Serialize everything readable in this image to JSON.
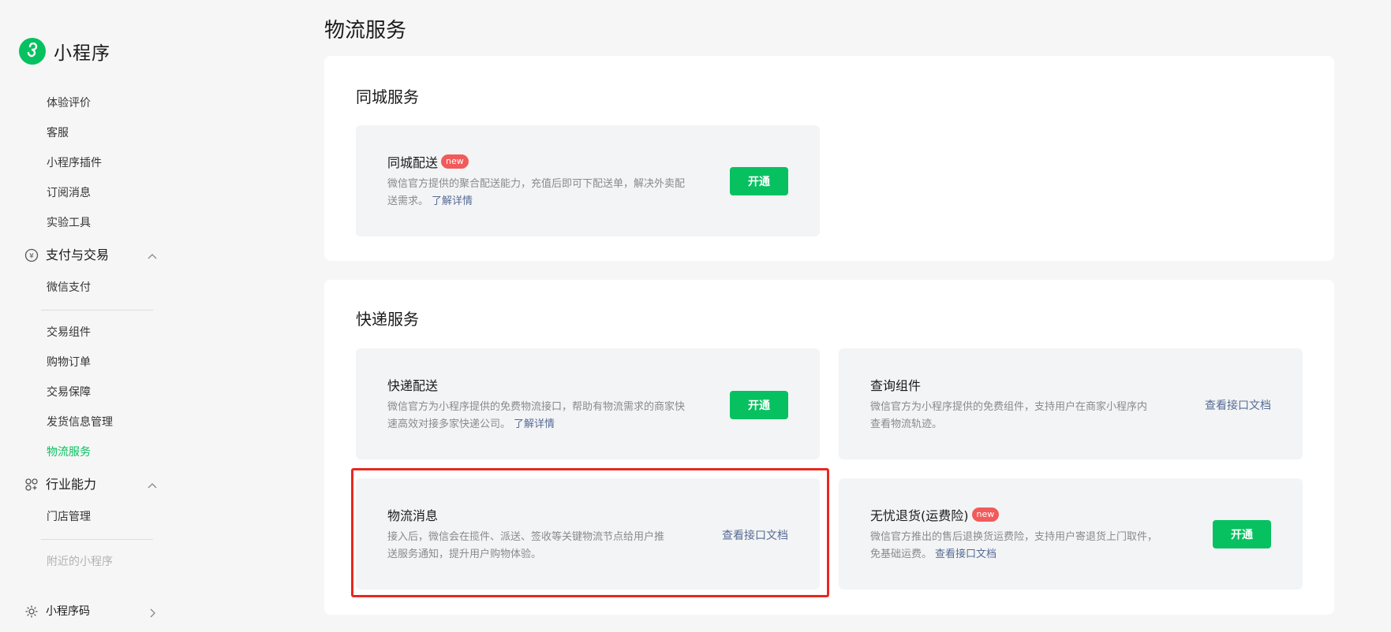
{
  "brand": {
    "name": "小程序"
  },
  "sidebar": {
    "items_top": [
      {
        "label": "体验评价"
      },
      {
        "label": "客服"
      },
      {
        "label": "小程序插件"
      },
      {
        "label": "订阅消息"
      },
      {
        "label": "实验工具"
      }
    ],
    "group_payment": {
      "label": "支付与交易",
      "items": [
        {
          "label": "微信支付"
        },
        {
          "label": "交易组件"
        },
        {
          "label": "购物订单"
        },
        {
          "label": "交易保障"
        },
        {
          "label": "发货信息管理"
        },
        {
          "label": "物流服务"
        }
      ]
    },
    "group_industry": {
      "label": "行业能力",
      "items": [
        {
          "label": "门店管理"
        },
        {
          "label": "附近的小程序"
        }
      ]
    },
    "bottom": {
      "label": "小程序码"
    }
  },
  "page": {
    "title": "物流服务"
  },
  "city_section": {
    "title": "同城服务",
    "card": {
      "title": "同城配送",
      "badge": "new",
      "desc": "微信官方提供的聚合配送能力，充值后即可下配送单，解决外卖配送需求。",
      "link": "了解详情",
      "button": "开通"
    }
  },
  "express_section": {
    "title": "快递服务",
    "cards": [
      {
        "title": "快递配送",
        "desc": "微信官方为小程序提供的免费物流接口，帮助有物流需求的商家快速高效对接多家快递公司。",
        "link": "了解详情",
        "button": "开通"
      },
      {
        "title": "查询组件",
        "desc": "微信官方为小程序提供的免费组件，支持用户在商家小程序内查看物流轨迹。",
        "action": "查看接口文档"
      },
      {
        "title": "物流消息",
        "desc": "接入后，微信会在揽件、派送、签收等关键物流节点给用户推送服务通知，提升用户购物体验。",
        "action": "查看接口文档"
      },
      {
        "title": "无忧退货(运费险)",
        "badge": "new",
        "desc": "微信官方推出的售后退换货运费险，支持用户寄退货上门取件，免基础运费。",
        "link": "查看接口文档",
        "button": "开通"
      }
    ]
  },
  "colors": {
    "accent": "#07c160",
    "link": "#576b95",
    "badge": "#f15b5b",
    "highlight": "#e8281f"
  }
}
